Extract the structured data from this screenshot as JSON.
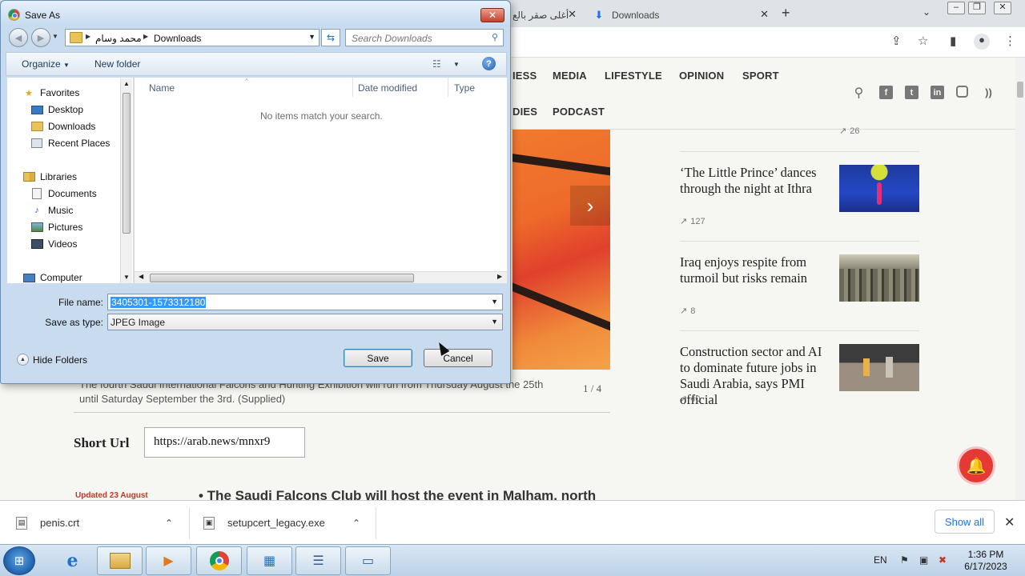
{
  "browser": {
    "tabs": [
      {
        "label": "أغلى صقر بالع"
      },
      {
        "label": "Downloads"
      }
    ],
    "new_tab_symbol": "+"
  },
  "site": {
    "nav": {
      "row1": [
        "IESS",
        "MEDIA",
        "LIFESTYLE",
        "OPINION",
        "SPORT"
      ],
      "row2": [
        "DIES",
        "PODCAST"
      ]
    },
    "caption": "The fourth Saudi International Falcons and Hunting Exhibition will run from Thursday August the 25th until Saturday September the 3rd. (Supplied)",
    "slide_counter": "1 / 4",
    "short_url_label": "Short Url",
    "short_url_value": "https://arab.news/mnxr9",
    "updated_label": "Updated 23 August",
    "body_first_line": "• The Saudi Falcons Club will host the event in Malham, north",
    "sidebar_articles": [
      {
        "title": "‘The Little Prince’ dances through the night at Ithra",
        "count": "127"
      },
      {
        "title": "Iraq enjoys respite from turmoil but risks remain",
        "count": "8"
      },
      {
        "title": "Construction sector and AI to dominate future jobs in Saudi Arabia, says PMI official",
        "count": "40"
      }
    ],
    "top_count": "26"
  },
  "downloads": {
    "items": [
      {
        "name": "penis.crt"
      },
      {
        "name": "setupcert_legacy.exe"
      }
    ],
    "show_all_label": "Show all"
  },
  "taskbar": {
    "language": "EN",
    "time": "1:36 PM",
    "date": "6/17/2023"
  },
  "dialog": {
    "title": "Save As",
    "breadcrumb": [
      "محمد وسام",
      "Downloads"
    ],
    "search_placeholder": "Search Downloads",
    "toolbar": {
      "organize_label": "Organize",
      "new_folder_label": "New folder"
    },
    "nav_tree": {
      "favorites": "Favorites",
      "favorites_items": [
        "Desktop",
        "Downloads",
        "Recent Places"
      ],
      "libraries": "Libraries",
      "libraries_items": [
        "Documents",
        "Music",
        "Pictures",
        "Videos"
      ],
      "computer": "Computer"
    },
    "columns": [
      "Name",
      "Date modified",
      "Type"
    ],
    "empty_message": "No items match your search.",
    "file_name_label": "File name:",
    "file_name_value": "3405301-1573312180",
    "save_type_label": "Save as type:",
    "save_type_value": "JPEG Image",
    "hide_folders_label": "Hide Folders",
    "save_label": "Save",
    "cancel_label": "Cancel"
  }
}
